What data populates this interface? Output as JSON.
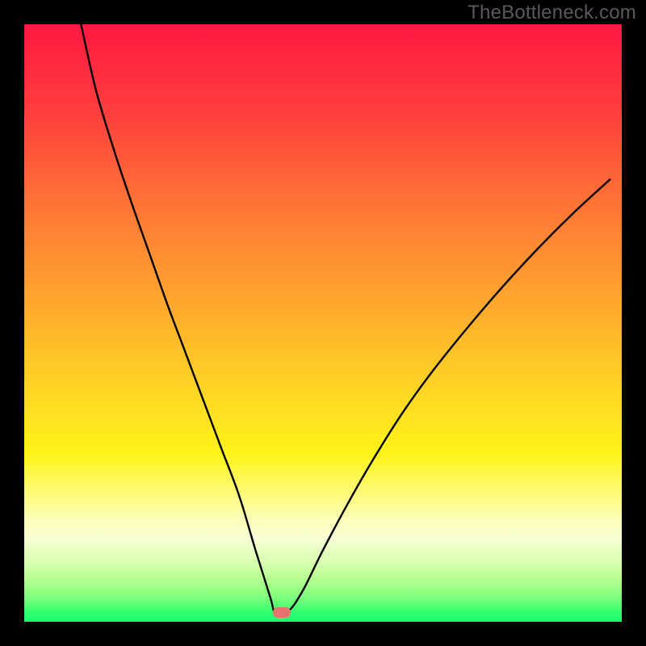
{
  "watermark": "TheBottleneck.com",
  "chart_data": {
    "type": "line",
    "title": "",
    "xlabel": "",
    "ylabel": "",
    "xlim": [
      0,
      100
    ],
    "ylim": [
      0,
      100
    ],
    "grid": false,
    "legend": false,
    "series": [
      {
        "name": "curve",
        "x": [
          9.5,
          12,
          15,
          18,
          21,
          24,
          27,
          30,
          33,
          36,
          38.7,
          41.2,
          42,
          44,
          46.5,
          50,
          54,
          58,
          63,
          68,
          74,
          80,
          86,
          92,
          98
        ],
        "values": [
          100,
          89,
          79,
          70,
          61.5,
          53,
          45,
          37,
          29,
          21,
          12,
          4,
          1.6,
          1.6,
          5,
          12,
          19.5,
          26.5,
          34.5,
          41.5,
          49,
          56,
          62.5,
          68.5,
          74
        ]
      }
    ],
    "marker": {
      "x_center": 43.1,
      "y_center": 1.6,
      "color": "#e8736f"
    },
    "background_gradient": [
      "#ff1842",
      "#ffa22e",
      "#fff31a",
      "#fdffb4",
      "#2eff6e"
    ]
  }
}
